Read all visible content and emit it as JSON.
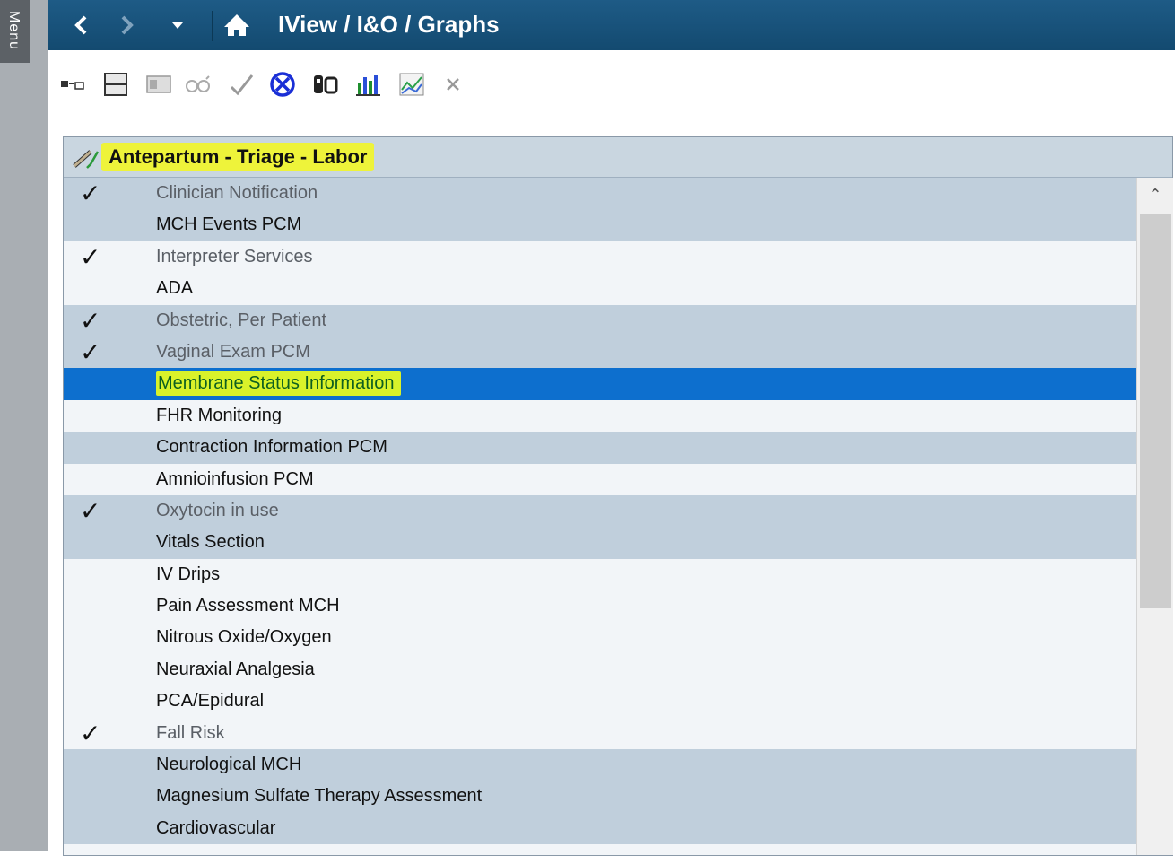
{
  "menu": {
    "label": "Menu"
  },
  "titlebar": {
    "back_icon": "chevron-left-icon",
    "forward_icon": "chevron-right-icon",
    "dropdown_icon": "caret-down-icon",
    "home_icon": "home-icon",
    "title": "IView / I&O / Graphs"
  },
  "toolbar": {
    "icons": [
      "insert-row-icon",
      "split-view-icon",
      "table-icon",
      "glasses-icon",
      "check-icon",
      "not-done-icon",
      "compare-icon",
      "bar-chart-icon",
      "line-chart-icon",
      "close-icon"
    ]
  },
  "panel": {
    "header_title": "Antepartum - Triage - Labor",
    "rows": [
      {
        "label": "Clinician Notification",
        "checked": true,
        "documented": true,
        "band": "a"
      },
      {
        "label": "MCH Events PCM",
        "checked": false,
        "documented": false,
        "band": "a"
      },
      {
        "label": "Interpreter Services",
        "checked": true,
        "documented": true,
        "band": "b"
      },
      {
        "label": "ADA",
        "checked": false,
        "documented": false,
        "band": "b"
      },
      {
        "label": "Obstetric, Per Patient",
        "checked": true,
        "documented": true,
        "band": "a"
      },
      {
        "label": "Vaginal Exam PCM",
        "checked": true,
        "documented": true,
        "band": "a"
      },
      {
        "label": "Membrane Status Information",
        "checked": false,
        "documented": false,
        "band": "selected"
      },
      {
        "label": "FHR Monitoring",
        "checked": false,
        "documented": false,
        "band": "b"
      },
      {
        "label": "Contraction Information PCM",
        "checked": false,
        "documented": false,
        "band": "a"
      },
      {
        "label": "Amnioinfusion PCM",
        "checked": false,
        "documented": false,
        "band": "b"
      },
      {
        "label": "Oxytocin in use",
        "checked": true,
        "documented": true,
        "band": "a"
      },
      {
        "label": "Vitals Section",
        "checked": false,
        "documented": false,
        "band": "a"
      },
      {
        "label": "IV Drips",
        "checked": false,
        "documented": false,
        "band": "b"
      },
      {
        "label": "Pain Assessment MCH",
        "checked": false,
        "documented": false,
        "band": "b"
      },
      {
        "label": "Nitrous Oxide/Oxygen",
        "checked": false,
        "documented": false,
        "band": "b"
      },
      {
        "label": "Neuraxial Analgesia",
        "checked": false,
        "documented": false,
        "band": "b"
      },
      {
        "label": "PCA/Epidural",
        "checked": false,
        "documented": false,
        "band": "b"
      },
      {
        "label": "Fall Risk",
        "checked": true,
        "documented": true,
        "band": "b"
      },
      {
        "label": "Neurological MCH",
        "checked": false,
        "documented": false,
        "band": "a"
      },
      {
        "label": "Magnesium Sulfate Therapy Assessment",
        "checked": false,
        "documented": false,
        "band": "a"
      },
      {
        "label": "Cardiovascular",
        "checked": false,
        "documented": false,
        "band": "a"
      }
    ],
    "check_glyph": "✓"
  },
  "colors": {
    "titlebar": "#134a70",
    "selected_row": "#0d6fce",
    "highlight": "#d9f22a",
    "band_a": "#c0cfdc"
  }
}
